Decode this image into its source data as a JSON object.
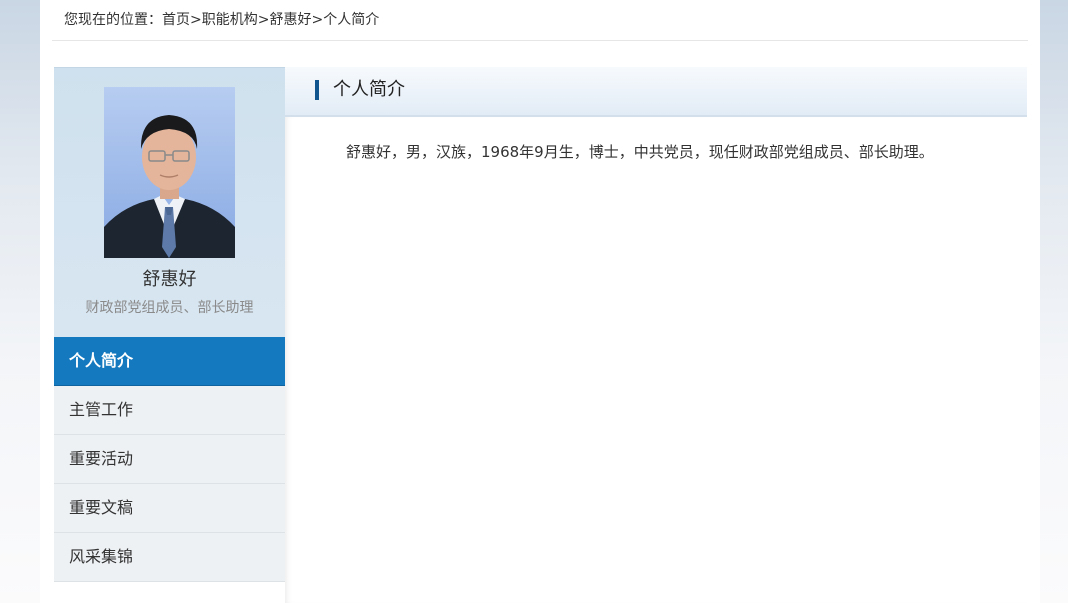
{
  "breadcrumb": {
    "prefix": "您现在的位置：",
    "items": [
      "首页",
      "职能机构",
      "舒惠好",
      "个人简介"
    ],
    "separator": ">"
  },
  "profile": {
    "name": "舒惠好",
    "title": "财政部党组成员、部长助理"
  },
  "nav": {
    "items": [
      {
        "label": "个人简介",
        "active": true
      },
      {
        "label": "主管工作",
        "active": false
      },
      {
        "label": "重要活动",
        "active": false
      },
      {
        "label": "重要文稿",
        "active": false
      },
      {
        "label": "风采集锦",
        "active": false
      }
    ]
  },
  "content": {
    "title": "个人简介",
    "bio": "舒惠好，男，汉族，1968年9月生，博士，中共党员，现任财政部党组成员、部长助理。"
  },
  "colors": {
    "accent": "#1479be",
    "header_bar": "#10558e",
    "profile_bg": "#cfe1ee",
    "nav_bg": "#eef1f4"
  }
}
